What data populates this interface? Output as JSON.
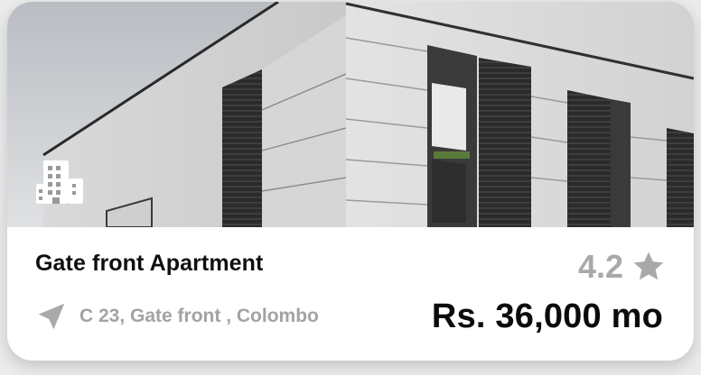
{
  "listing": {
    "title": "Gate front Apartment",
    "rating": "4.2",
    "address": "C 23, Gate front , Colombo",
    "price": "Rs. 36,000 mo"
  },
  "icons": {
    "type_icon": "building-icon",
    "rating_icon": "star-icon",
    "location_icon": "location-arrow-icon"
  },
  "colors": {
    "muted_text": "#a9a9a9",
    "primary_text": "#0f0f0f"
  }
}
